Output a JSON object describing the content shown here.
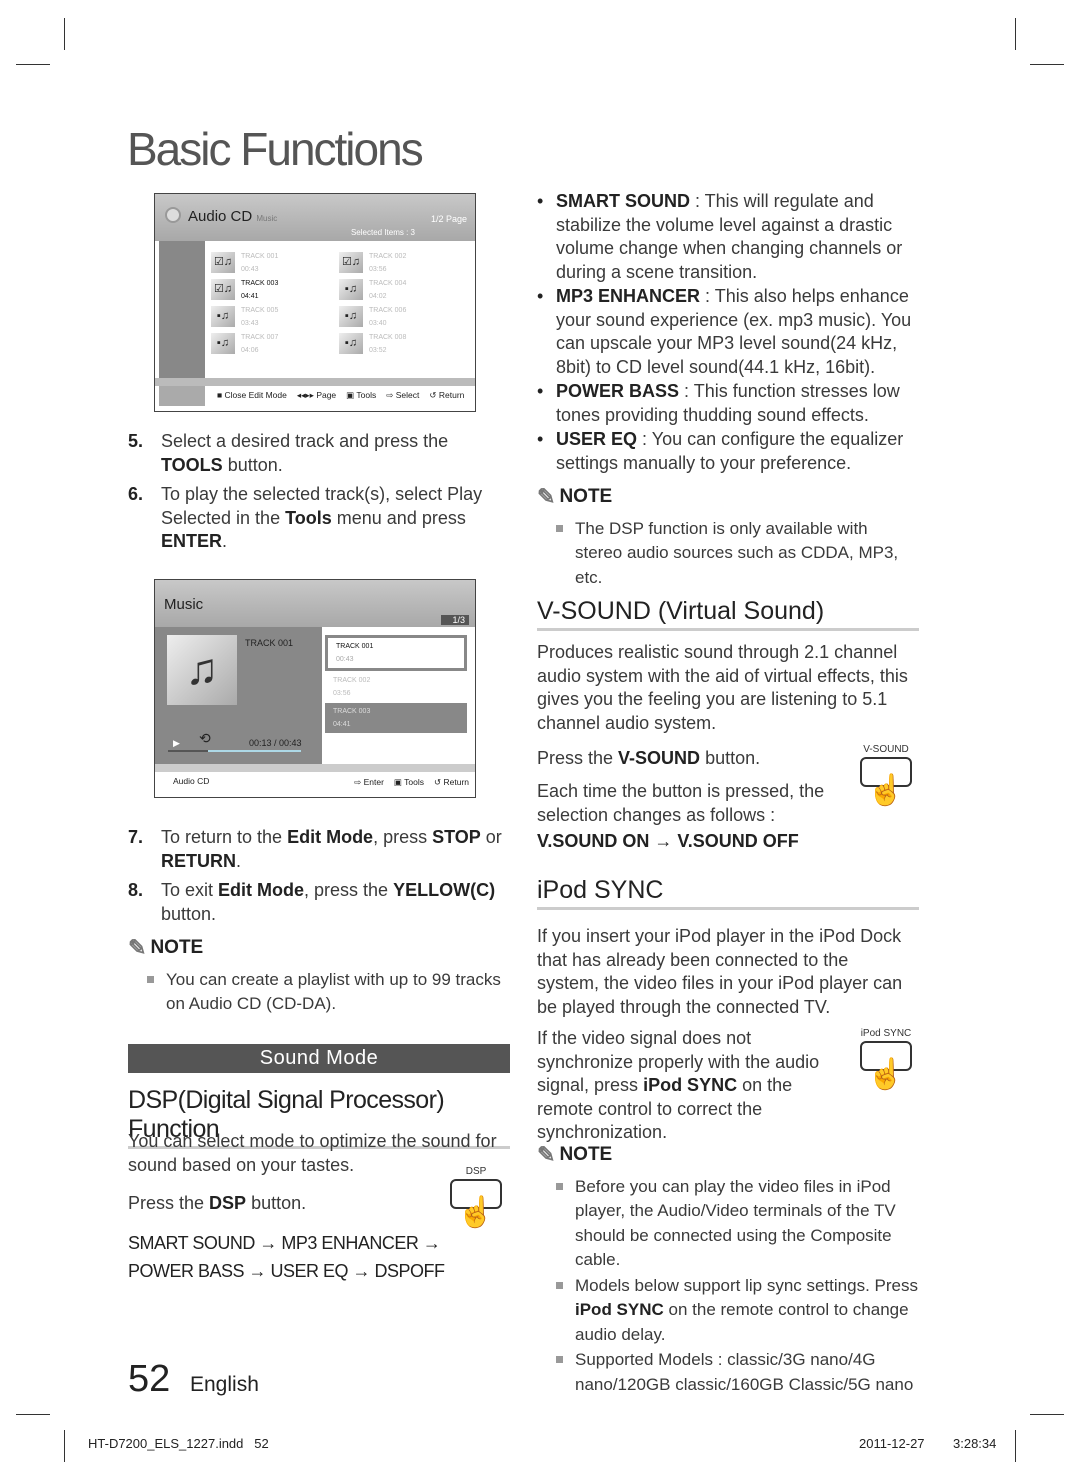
{
  "page_title": "Basic Functions",
  "screen1": {
    "title": "Audio CD",
    "subtitle": "Music",
    "page": "1/2 Page",
    "selected": "Selected Items : 3",
    "tracks": [
      {
        "name": "TRACK 001",
        "time": "00:43",
        "checked": true
      },
      {
        "name": "TRACK 002",
        "time": "03:56",
        "checked": true
      },
      {
        "name": "TRACK 003",
        "time": "04:41",
        "checked": true
      },
      {
        "name": "TRACK 004",
        "time": "04:02",
        "checked": false
      },
      {
        "name": "TRACK 005",
        "time": "03:43",
        "checked": false
      },
      {
        "name": "TRACK 006",
        "time": "03:40",
        "checked": false
      },
      {
        "name": "TRACK 007",
        "time": "04:06",
        "checked": false
      },
      {
        "name": "TRACK 008",
        "time": "03:52",
        "checked": false
      }
    ],
    "footer": [
      "Close Edit Mode",
      "Page",
      "Tools",
      "Select",
      "Return"
    ]
  },
  "steps_a": [
    {
      "n": "5.",
      "html": "Select a desired track and press the <b>TOOLS</b> button."
    },
    {
      "n": "6.",
      "html": "To play the selected track(s), select Play Selected in the <b>Tools</b> menu and press <b>ENTER</b>."
    }
  ],
  "screen2": {
    "title": "Music",
    "page": "1/3",
    "now": "TRACK 001",
    "elapsed": "00:13 / 00:43",
    "progress": 0.3,
    "list": [
      {
        "name": "TRACK 001",
        "time": "00:43"
      },
      {
        "name": "TRACK 002",
        "time": "03:56"
      },
      {
        "name": "TRACK 003",
        "time": "04:41"
      }
    ],
    "source": "Audio CD",
    "footer": [
      "Enter",
      "Tools",
      "Return"
    ]
  },
  "steps_b": [
    {
      "n": "7.",
      "html": "To return to the <b>Edit Mode</b>, press <b>STOP</b> or <b>RETURN</b>."
    },
    {
      "n": "8.",
      "html": "To exit <b>Edit Mode</b>, press the <b>YELLOW(C)</b> button."
    }
  ],
  "note_label": "NOTE",
  "note_left": "You can create a playlist with up to 99 tracks on Audio CD (CD-DA).",
  "sound_mode": "Sound Mode",
  "dsp_title": "DSP(Digital Signal Processor) Function",
  "dsp_intro": "You can select mode to optimize the sound for sound based on your tastes.",
  "dsp_press": "Press the <b>DSP</b> button.",
  "dsp_button": "DSP",
  "dsp_seq1": "SMART SOUND → MP3 ENHANCER →",
  "dsp_seq2": "POWER BASS → USER EQ → DSPOFF",
  "modes": [
    {
      "html": "<b>SMART SOUND</b> : This will regulate and stabilize the volume level against a drastic volume change when changing channels or during a scene transition."
    },
    {
      "html": "<b>MP3 ENHANCER</b> : This also helps enhance your sound experience (ex. mp3 music). You can upscale your MP3 level sound(24 kHz, 8bit) to CD level sound(44.1 kHz, 16bit)."
    },
    {
      "html": "<b>POWER BASS</b> : This function stresses low tones providing thudding sound effects."
    },
    {
      "html": "<b>USER EQ</b> : You can configure the equalizer settings manually to your preference."
    }
  ],
  "note_dsp": "The DSP function is only available with stereo audio sources such as CDDA, MP3, etc.",
  "vsound_title": "V-SOUND (Virtual Sound)",
  "vsound_intro": "Produces realistic sound through 2.1 channel audio system with the aid of virtual effects, this gives you the feeling you are listening to 5.1 channel audio system.",
  "vsound_press": "Press the <b>V-SOUND</b> button.",
  "vsound_each": "Each time the button is pressed, the selection changes as follows :",
  "vsound_seq": "V.SOUND ON → V.SOUND OFF",
  "vsound_button": "V-SOUND",
  "ipod_title": "iPod SYNC",
  "ipod_intro": "If you insert your iPod player in the iPod Dock that has already been connected to the system, the video files in your iPod player can be played through the connected TV.",
  "ipod_sync": "If the video signal does not synchronize properly with the audio signal, press <b>iPod SYNC</b> on the remote control to correct the synchronization.",
  "ipod_button": "iPod SYNC",
  "ipod_notes": [
    {
      "html": "Before you can play the video files in iPod player, the Audio/Video terminals of the TV should be connected using the Composite cable."
    },
    {
      "html": "Models below support lip sync settings. Press <b>iPod SYNC</b> on the remote control to change audio delay."
    },
    {
      "html": "Supported Models : classic/3G nano/4G nano/120GB classic/160GB Classic/5G nano"
    }
  ],
  "page_number": "52",
  "language": "English",
  "slug_file": "HT-D7200_ELS_1227.indd   52",
  "slug_date": "2011-12-27",
  "slug_time": "3:28:34"
}
